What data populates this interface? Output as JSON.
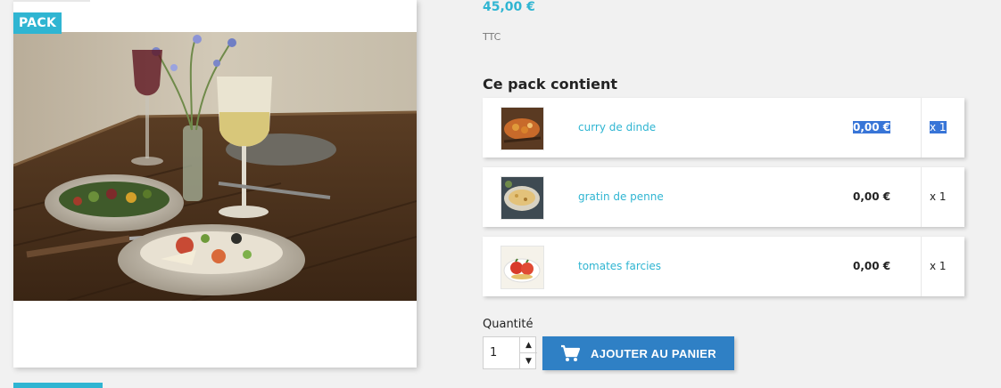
{
  "product": {
    "badge": "PACK",
    "image_icon": "food-photo",
    "price": "45,00 €",
    "tax_label": "TTC"
  },
  "pack": {
    "title": "Ce pack contient",
    "items": [
      {
        "name": "curry de dinde",
        "price": "0,00 €",
        "quantity": "x 1",
        "selected": true,
        "thumb_icon": "curry-dish-thumbnail"
      },
      {
        "name": "gratin de penne",
        "price": "0,00 €",
        "quantity": "x 1",
        "selected": false,
        "thumb_icon": "gratin-dish-thumbnail"
      },
      {
        "name": "tomates farcies",
        "price": "0,00 €",
        "quantity": "x 1",
        "selected": false,
        "thumb_icon": "stuffed-tomato-thumbnail"
      }
    ]
  },
  "cart": {
    "quantity_label": "Quantité",
    "quantity_value": "1",
    "add_label": "AJOUTER AU PANIER",
    "add_icon": "shopping-cart-icon"
  },
  "colors": {
    "accent": "#2fb5d2",
    "button": "#2f80c5",
    "selection": "#3875d7"
  }
}
